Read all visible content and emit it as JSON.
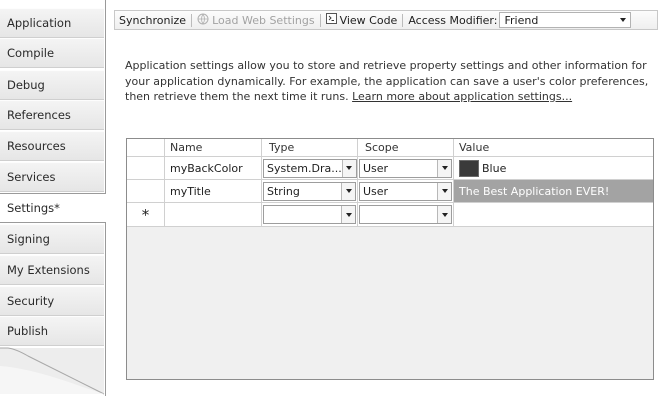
{
  "tabs": [
    "Application",
    "Compile",
    "Debug",
    "References",
    "Resources",
    "Services",
    "Settings*",
    "Signing",
    "My Extensions",
    "Security",
    "Publish"
  ],
  "selected_tab": "Settings*",
  "toolbar": {
    "synchronize": "Synchronize",
    "load_web_settings": "Load Web Settings",
    "view_code": "View Code",
    "access_modifier_label": "Access Modifier:",
    "access_modifier_value": "Friend"
  },
  "description": {
    "text": "Application settings allow you to store and retrieve property settings and other information for your application dynamically. For example, the application can save a user's color preferences, then retrieve them the next time it runs.",
    "link": "Learn more about application settings..."
  },
  "grid": {
    "columns": [
      "Name",
      "Type",
      "Scope",
      "Value"
    ],
    "rows": [
      {
        "name": "myBackColor",
        "type": "System.Dra...",
        "scope": "User",
        "value": "Blue",
        "swatch_color": "#3a3a3a"
      },
      {
        "name": "myTitle",
        "type": "String",
        "scope": "User",
        "value": "The Best Application EVER!"
      }
    ],
    "new_row_marker": "*"
  },
  "colors": {
    "selected_cell": "#a3a3a3",
    "tab_border": "#9a9a9a"
  }
}
